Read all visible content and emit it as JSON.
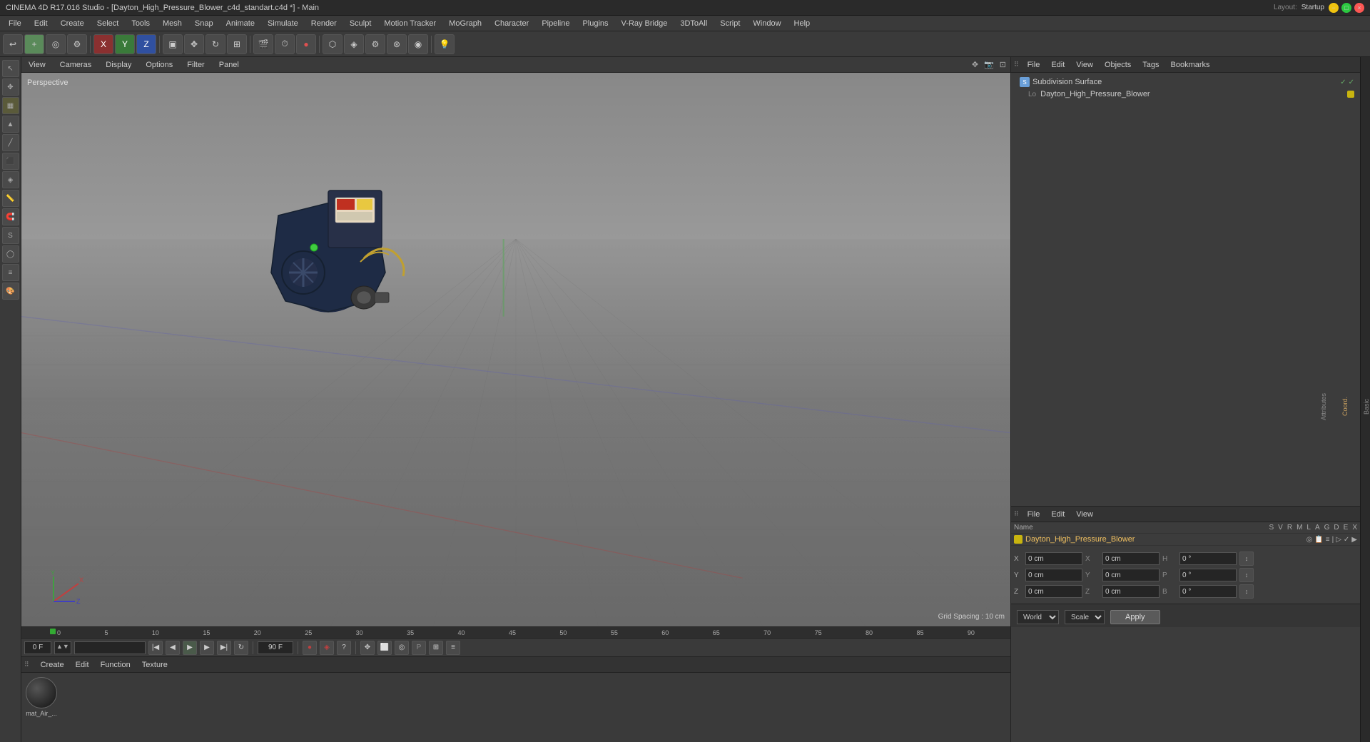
{
  "titlebar": {
    "title": "CINEMA 4D R17.016 Studio - [Dayton_High_Pressure_Blower_c4d_standart.c4d *] - Main",
    "layout_label": "Layout:",
    "layout_value": "Startup"
  },
  "menubar": {
    "items": [
      "File",
      "Edit",
      "Create",
      "Select",
      "Tools",
      "Mesh",
      "Snap",
      "Animate",
      "Simulate",
      "Render",
      "Sculpt",
      "Motion Tracker",
      "MoGraph",
      "Character",
      "Pipeline",
      "Plugins",
      "V-Ray Bridge",
      "3DToAll",
      "Script",
      "Window",
      "Help"
    ]
  },
  "viewport": {
    "label": "Perspective",
    "grid_spacing": "Grid Spacing : 10 cm",
    "menus": [
      "View",
      "Cameras",
      "Display",
      "Options",
      "Filter",
      "Panel"
    ]
  },
  "objects_panel": {
    "header_menus": [
      "File",
      "Edit",
      "View",
      "Objects",
      "Tags",
      "Bookmarks"
    ],
    "items": [
      {
        "name": "Subdivision Surface",
        "type": "subdiv",
        "checks": [
          "✓",
          "✓"
        ]
      },
      {
        "name": "Dayton_High_Pressure_Blower",
        "type": "null",
        "dot_color": "#c8b40f"
      }
    ]
  },
  "attributes_panel": {
    "header_menus": [
      "File",
      "Edit",
      "View"
    ],
    "columns": [
      "Name",
      "S",
      "V",
      "R",
      "M",
      "L",
      "A",
      "G",
      "D",
      "E",
      "X"
    ],
    "selected_object": "Dayton_High_Pressure_Blower",
    "selected_color": "#c8b40f"
  },
  "coordinates": {
    "x_pos": "0 cm",
    "y_pos": "0 cm",
    "z_pos": "0 cm",
    "x_rot": "0 cm",
    "y_rot": "0 cm",
    "z_rot": "0 cm",
    "h_val": "0 °",
    "p_val": "0 °",
    "b_val": "0 °",
    "coord_system": "World",
    "scale_label": "Scale",
    "apply_label": "Apply"
  },
  "timeline": {
    "start": "0 F",
    "end": "90 F",
    "current": "0 F",
    "markers": [
      "0",
      "5",
      "10",
      "15",
      "20",
      "25",
      "30",
      "35",
      "40",
      "45",
      "50",
      "55",
      "60",
      "65",
      "70",
      "75",
      "80",
      "85",
      "90"
    ]
  },
  "playback": {
    "frame_label": "0 F",
    "end_frame": "90 F",
    "start_frame": "0 F"
  },
  "material_panel": {
    "header_menus": [
      "Create",
      "Edit",
      "Function",
      "Texture"
    ],
    "materials": [
      {
        "name": "mat_Air_..."
      }
    ]
  },
  "far_right": {
    "tabs": [
      "Basic",
      "Coord.",
      "Attributes"
    ]
  },
  "icons": {
    "undo": "↩",
    "redo": "↪",
    "play": "▶",
    "stop": "■",
    "prev": "◀",
    "next": "▶",
    "first": "⏮",
    "last": "⏭",
    "record": "●"
  }
}
